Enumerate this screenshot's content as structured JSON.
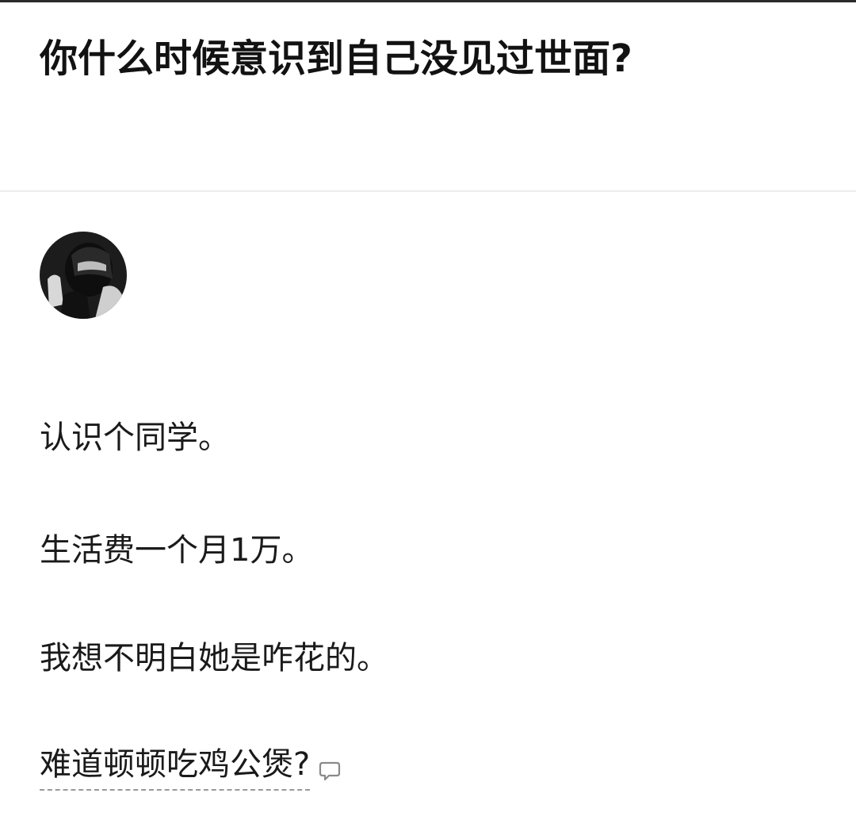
{
  "question": {
    "title": "你什么时候意识到自己没见过世面?"
  },
  "answer": {
    "avatar_icon": "user-avatar",
    "paragraphs": [
      "认识个同学。",
      "生活费一个月1万。",
      "我想不明白她是咋花的。",
      "难道顿顿吃鸡公煲?"
    ],
    "annotation_icon": "comment-bubble-icon"
  },
  "colors": {
    "text": "#1a1a1a",
    "title": "#121212",
    "divider": "#ececec",
    "dashed_underline": "#9a9a9a"
  }
}
